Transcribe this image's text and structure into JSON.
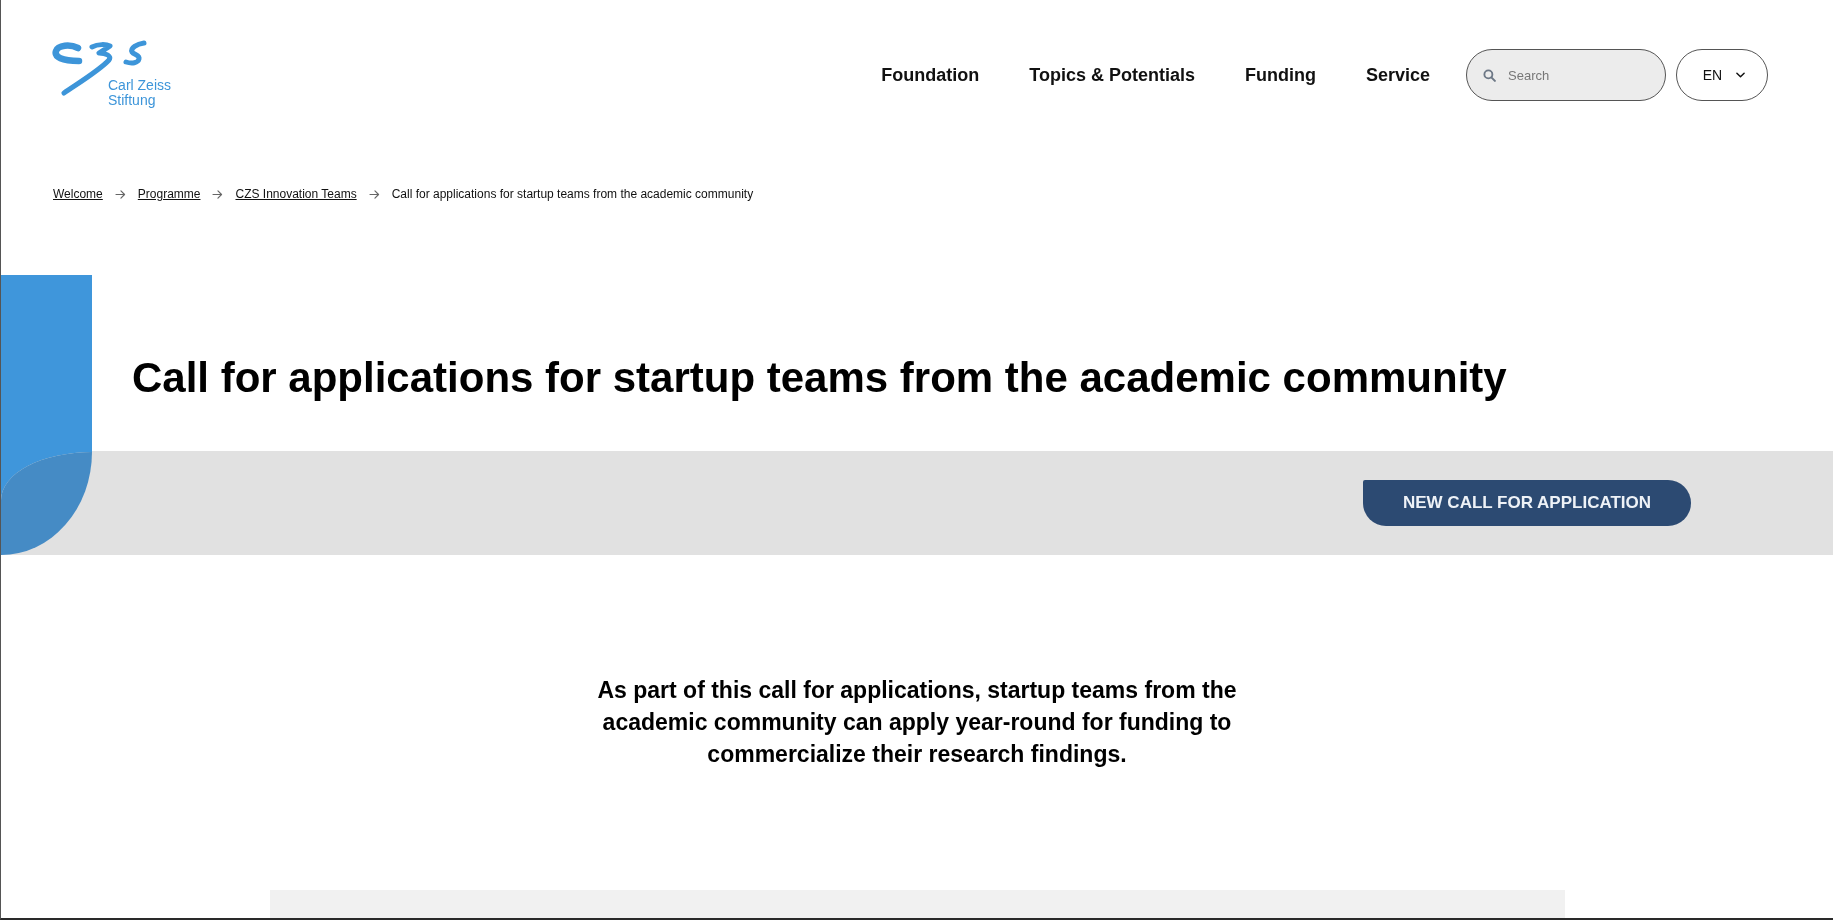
{
  "header": {
    "logo": {
      "line_1": "Carl Zeiss",
      "line_2": "Stiftung"
    },
    "nav": [
      "Foundation",
      "Topics & Potentials",
      "Funding",
      "Service"
    ],
    "search": {
      "placeholder": "Search"
    },
    "language": {
      "value": "EN"
    }
  },
  "breadcrumb": [
    {
      "label": "Welcome",
      "kind": "link"
    },
    {
      "label": "Programme",
      "kind": "link"
    },
    {
      "label": "CZS Innovation Teams",
      "kind": "link"
    },
    {
      "label": "Call for applications for startup teams from the academic community",
      "kind": "current"
    }
  ],
  "hero": {
    "title": "Call for applications for startup teams from the academic community",
    "button": "NEW CALL FOR APPLICATION"
  },
  "intro": {
    "text": "As part of this call for applications, startup teams from the academic community can apply year-round for funding to commercialize their research findings."
  }
}
